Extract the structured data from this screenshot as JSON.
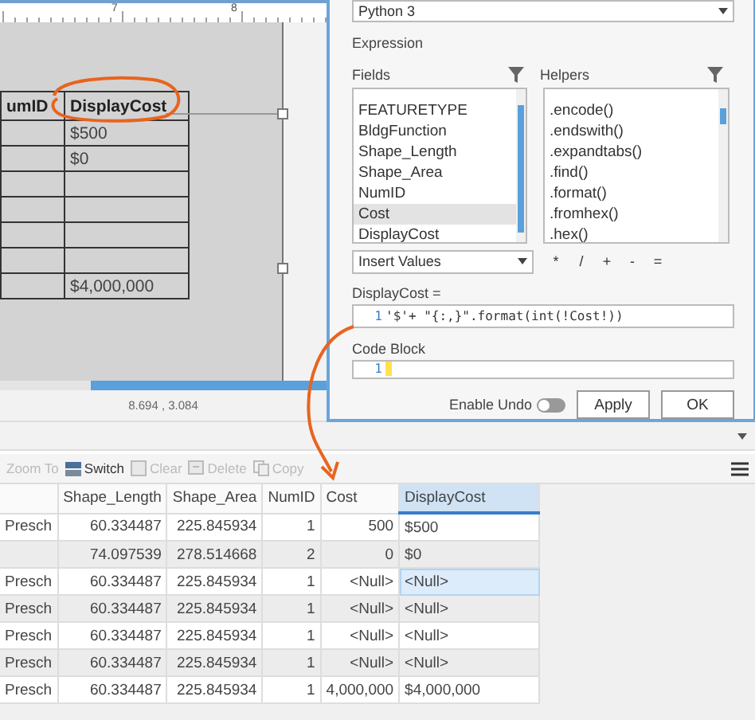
{
  "layout_view": {
    "ruler_labels": [
      "7",
      "8"
    ],
    "table": {
      "columns": [
        "umID",
        "DisplayCost"
      ],
      "rows": [
        {
          "display_cost": "$500"
        },
        {
          "display_cost": "$0"
        },
        {},
        {},
        {},
        {},
        {
          "display_cost": "$4,000,000"
        }
      ]
    },
    "coordinates": "8.694 , 3.084"
  },
  "dialog": {
    "expression_type": {
      "value": "Python 3"
    },
    "expression_label": "Expression",
    "fields": {
      "label": "Fields",
      "items": [
        {
          "label": "FEATURETYPE",
          "selected": false
        },
        {
          "label": "BldgFunction",
          "selected": false
        },
        {
          "label": "Shape_Length",
          "selected": false
        },
        {
          "label": "Shape_Area",
          "selected": false
        },
        {
          "label": "NumID",
          "selected": false
        },
        {
          "label": "Cost",
          "selected": true
        },
        {
          "label": "DisplayCost",
          "selected": false
        }
      ]
    },
    "helpers": {
      "label": "Helpers",
      "items": [
        {
          "label": ".encode()",
          "selected": false
        },
        {
          "label": ".endswith()",
          "selected": false
        },
        {
          "label": ".expandtabs()",
          "selected": false
        },
        {
          "label": ".find()",
          "selected": false
        },
        {
          "label": ".format()",
          "selected": false
        },
        {
          "label": ".fromhex()",
          "selected": false
        },
        {
          "label": ".hex()",
          "selected": false
        }
      ]
    },
    "insert_values": "Insert Values",
    "operators": [
      "*",
      "/",
      "+",
      "-",
      "="
    ],
    "expression": {
      "label": "DisplayCost =",
      "lines": [
        {
          "number": "1",
          "code": "'$'+ \"{:,}\".format(int(!Cost!))"
        }
      ]
    },
    "code_block": {
      "label": "Code Block",
      "lines": [
        {
          "number": "1"
        }
      ]
    },
    "enable_undo": {
      "label": "Enable Undo",
      "on": false
    },
    "buttons": [
      {
        "label": "Apply"
      },
      {
        "label": "OK"
      }
    ]
  },
  "attribute_table": {
    "toolbar": [
      {
        "label": "Zoom To",
        "kind": "plain",
        "disabled": true
      },
      {
        "label": "Switch",
        "kind": "switch",
        "disabled": false
      },
      {
        "label": "Clear",
        "kind": "clear",
        "disabled": true
      },
      {
        "label": "Delete",
        "kind": "delete",
        "disabled": true
      },
      {
        "label": "Copy",
        "kind": "copy",
        "disabled": true
      }
    ],
    "columns": [
      {
        "kind": "text",
        "selected": false
      },
      {
        "label": "Shape_Length",
        "kind": "number",
        "selected": false
      },
      {
        "label": "Shape_Area",
        "kind": "number",
        "selected": false
      },
      {
        "label": "NumID",
        "kind": "number",
        "selected": false
      },
      {
        "label": "Cost",
        "kind": "number",
        "selected": false
      },
      {
        "label": "DisplayCost",
        "kind": "text",
        "selected": true
      }
    ],
    "rows": [
      {
        "cells": [
          "Presch",
          "60.334487",
          "225.845934",
          "1",
          "500",
          "$500"
        ],
        "selected": false
      },
      {
        "cells": [
          null,
          "74.097539",
          "278.514668",
          "2",
          "0",
          "$0"
        ],
        "selected": false
      },
      {
        "cells": [
          "Presch",
          "60.334487",
          "225.845934",
          "1",
          "<Null>",
          "<Null>"
        ],
        "selected": true
      },
      {
        "cells": [
          "Presch",
          "60.334487",
          "225.845934",
          "1",
          "<Null>",
          "<Null>"
        ],
        "selected": false
      },
      {
        "cells": [
          "Presch",
          "60.334487",
          "225.845934",
          "1",
          "<Null>",
          "<Null>"
        ],
        "selected": false
      },
      {
        "cells": [
          "Presch",
          "60.334487",
          "225.845934",
          "1",
          "<Null>",
          "<Null>"
        ],
        "selected": false
      },
      {
        "cells": [
          "Presch",
          "60.334487",
          "225.845934",
          "1",
          "4,000,000",
          "$4,000,000"
        ],
        "selected": false
      }
    ]
  }
}
